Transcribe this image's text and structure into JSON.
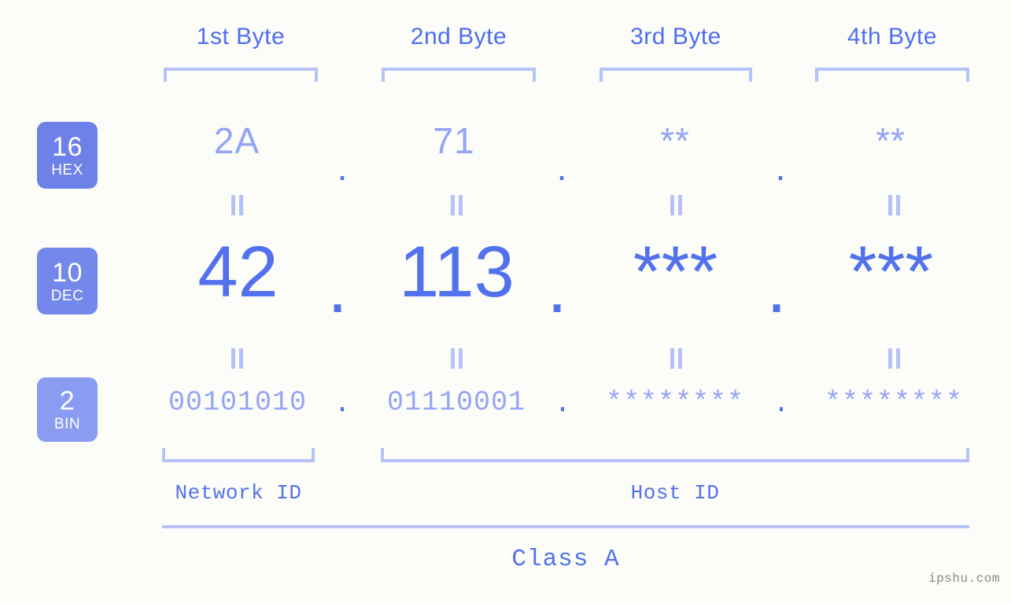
{
  "watermark": "ipshu.com",
  "byte_headers": [
    {
      "label": "1st Byte"
    },
    {
      "label": "2nd Byte"
    },
    {
      "label": "3rd Byte"
    },
    {
      "label": "4th Byte"
    }
  ],
  "bases": [
    {
      "num": "16",
      "name": "HEX"
    },
    {
      "num": "10",
      "name": "DEC"
    },
    {
      "num": "2",
      "name": "BIN"
    }
  ],
  "rows": {
    "hex": {
      "base_num": "16",
      "base_name": "HEX",
      "values": [
        "2A",
        "71",
        "**",
        "**"
      ],
      "separator": "."
    },
    "dec": {
      "base_num": "10",
      "base_name": "DEC",
      "values": [
        "42",
        "113",
        "***",
        "***"
      ],
      "separator": "."
    },
    "bin": {
      "base_num": "2",
      "base_name": "BIN",
      "values": [
        "00101010",
        "01110001",
        "********",
        "********"
      ],
      "separator": "."
    }
  },
  "connectors": {
    "glyph": "||"
  },
  "sections": [
    {
      "label": "Network ID"
    },
    {
      "label": "Host ID"
    }
  ],
  "class_label": "Class A",
  "colors": {
    "background": "#fcfdf8",
    "accent_strong": "#5271ed",
    "accent_light": "#93a4f5",
    "bracket": "#b6c2f6",
    "badge_hex": "#6e81e8",
    "badge_dec": "#7388ea",
    "badge_bin": "#8a9bf2",
    "watermark": "#8a8a8a"
  }
}
